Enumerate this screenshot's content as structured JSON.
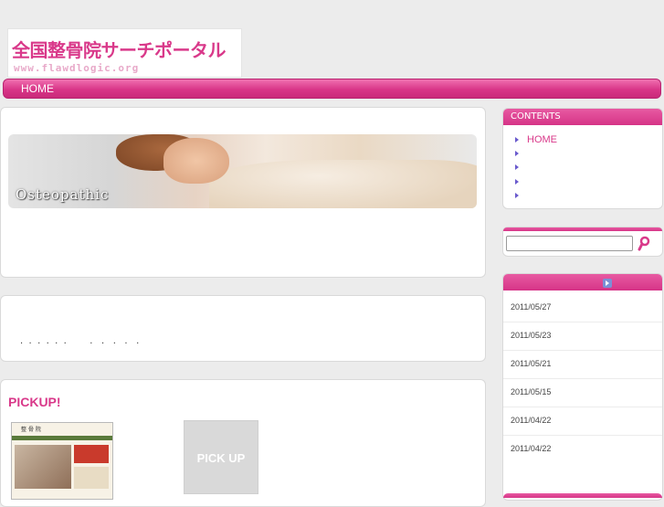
{
  "logo": {
    "title": "全国整骨院サーチポータル",
    "subtitle": "www.flawdlogic.org"
  },
  "nav": {
    "home_label": "HOME"
  },
  "hero": {
    "caption": "Osteopathic"
  },
  "news": {
    "dots": ".  .  .  .  .  .        .   .   .   .   ."
  },
  "pickup": {
    "title": "PICKUP!",
    "placeholder_label": "PICK UP"
  },
  "sidebar": {
    "contents_heading": "CONTENTS",
    "menu": [
      {
        "label": "HOME"
      },
      {
        "label": ""
      },
      {
        "label": ""
      },
      {
        "label": ""
      },
      {
        "label": ""
      }
    ],
    "search": {
      "value": "",
      "placeholder": ""
    },
    "dates": [
      "2011/05/27",
      "2011/05/23",
      "2011/05/21",
      "2011/05/15",
      "2011/04/22",
      "2011/04/22"
    ]
  },
  "colors": {
    "accent": "#d9398a",
    "nav_gradient_top": "#f070b0",
    "background": "#ececec"
  },
  "icons": {
    "menu_bullet": "triangle-right-icon",
    "search": "search-icon",
    "feed": "feed-icon"
  }
}
